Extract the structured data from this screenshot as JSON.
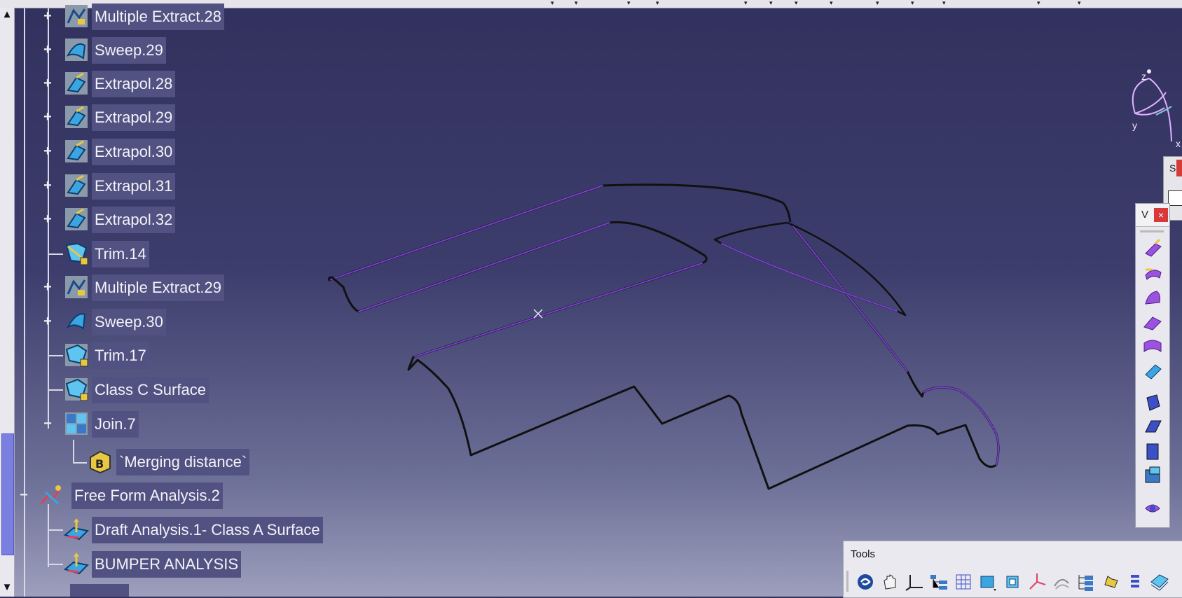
{
  "tree": {
    "items": [
      {
        "label": "Multiple Extract.28",
        "icon": "multiple-extract-icon",
        "expander": "plus"
      },
      {
        "label": "Sweep.29",
        "icon": "sweep-icon",
        "expander": "plus"
      },
      {
        "label": "Extrapol.28",
        "icon": "extrapol-icon",
        "expander": "plus"
      },
      {
        "label": "Extrapol.29",
        "icon": "extrapol-icon",
        "expander": "plus"
      },
      {
        "label": "Extrapol.30",
        "icon": "extrapol-icon",
        "expander": "plus"
      },
      {
        "label": "Extrapol.31",
        "icon": "extrapol-icon",
        "expander": "plus"
      },
      {
        "label": "Extrapol.32",
        "icon": "extrapol-icon",
        "expander": "plus"
      },
      {
        "label": "Trim.14",
        "icon": "trim-icon",
        "expander": "none"
      },
      {
        "label": "Multiple Extract.29",
        "icon": "multiple-extract-icon",
        "expander": "plus"
      },
      {
        "label": "Sweep.30",
        "icon": "sweep-icon",
        "expander": "plus"
      },
      {
        "label": "Trim.17",
        "icon": "trim-icon",
        "expander": "none"
      },
      {
        "label": "Class C Surface",
        "icon": "surface-icon",
        "expander": "none"
      },
      {
        "label": "Join.7",
        "icon": "join-icon",
        "expander": "minus"
      },
      {
        "label": "`Merging distance`",
        "icon": "parameter-icon",
        "expander": "none"
      },
      {
        "label": "Free Form Analysis.2",
        "icon": "free-form-analysis-icon",
        "expander": "minus"
      },
      {
        "label": "Draft Analysis.1- Class A Surface",
        "icon": "draft-analysis-icon",
        "expander": "none"
      },
      {
        "label": "BUMPER ANALYSIS",
        "icon": "draft-analysis-icon",
        "expander": "none"
      }
    ]
  },
  "compass": {
    "z": "z",
    "y": "y",
    "x": "x"
  },
  "side_panel": {
    "label": "S"
  },
  "vertical_toolbar": {
    "label": "V",
    "close": "×"
  },
  "tools_toolbar": {
    "title": "Tools"
  },
  "colors": {
    "background_top": "#32315e",
    "background_bottom": "#9d9fbd",
    "selection": "#525282",
    "edge_violet": "#7a3fd0"
  }
}
